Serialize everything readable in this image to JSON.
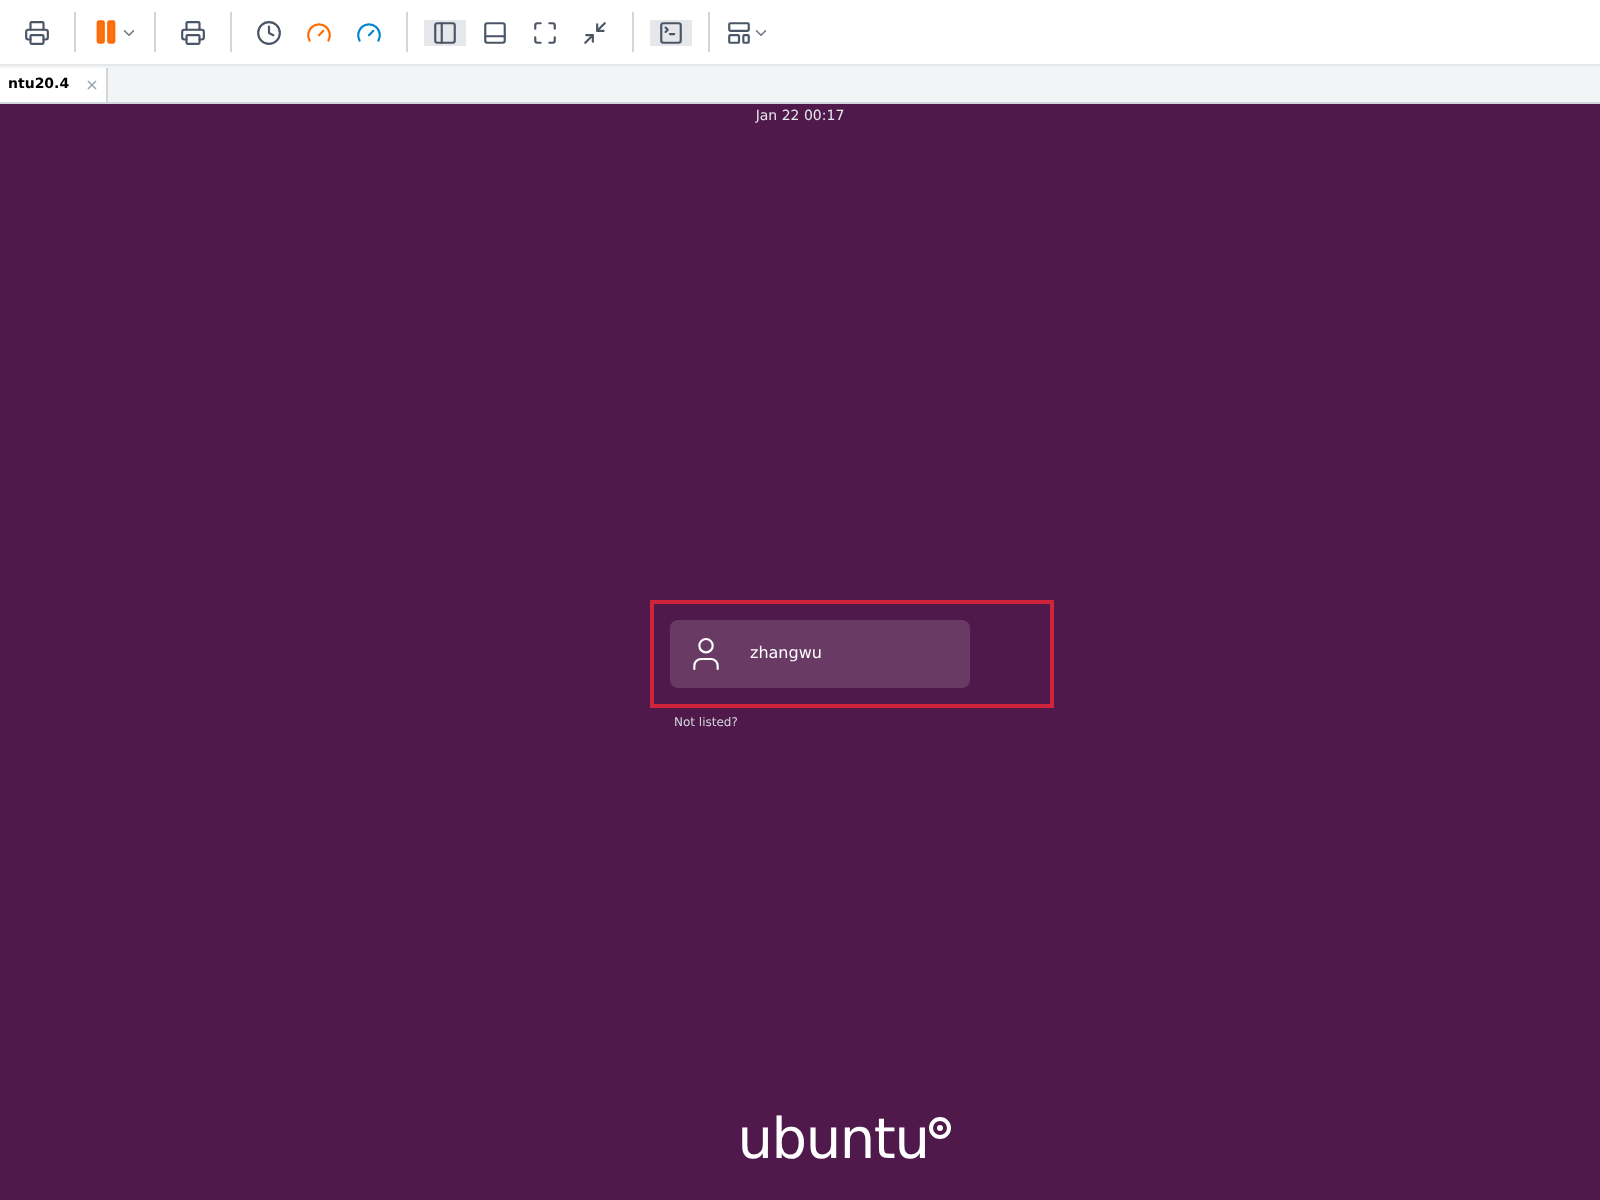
{
  "tab": {
    "label": "ntu20.4",
    "close": "×"
  },
  "clock": "Jan 22  00:17",
  "users": [
    {
      "name": "zhangwu",
      "highlighted": true
    }
  ],
  "not_listed": "Not listed?",
  "logo": "ubuntu"
}
